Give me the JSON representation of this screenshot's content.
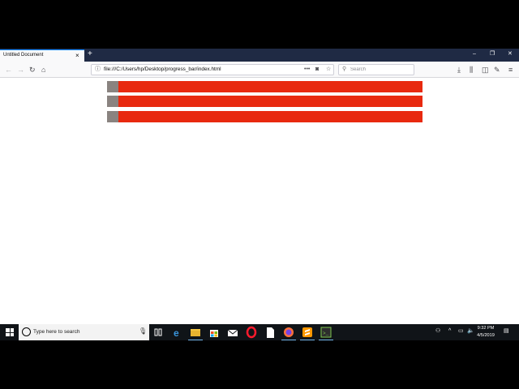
{
  "browser": {
    "tab_title": "Untitled Document",
    "tab_close": "×",
    "new_tab": "+",
    "window_controls": {
      "minimize": "–",
      "maximize": "❐",
      "close": "✕"
    },
    "url": "file:///C:/Users/hp/Desktop/progress_bar/index.html",
    "url_more": "•••",
    "search_placeholder": "Search",
    "icons": {
      "back": "back-icon",
      "forward": "forward-icon",
      "reload": "reload-icon",
      "home": "home-icon",
      "info": "info-icon",
      "pocket": "pocket-icon",
      "bookmark": "star-icon",
      "search": "search-icon",
      "downloads": "download-icon",
      "library": "library-icon",
      "sidebar": "sidebar-icon",
      "customize": "eyedropper-icon",
      "menu": "hamburger-menu-icon"
    }
  },
  "page": {
    "progress_bars": [
      {
        "progress": 0.035
      },
      {
        "progress": 0.035
      },
      {
        "progress": 0.035
      }
    ],
    "colors": {
      "track": "#e8290f",
      "fill": "#8a8380"
    }
  },
  "taskbar": {
    "search_placeholder": "Type here to search",
    "apps": [
      "task-view-icon",
      "edge-icon",
      "file-explorer-icon",
      "store-icon",
      "mail-icon",
      "opera-icon",
      "file-icon",
      "firefox-icon",
      "sublime-icon",
      "terminal-icon"
    ],
    "time": "9:32 PM",
    "date": "4/5/2019",
    "notifications_badge": "1"
  }
}
